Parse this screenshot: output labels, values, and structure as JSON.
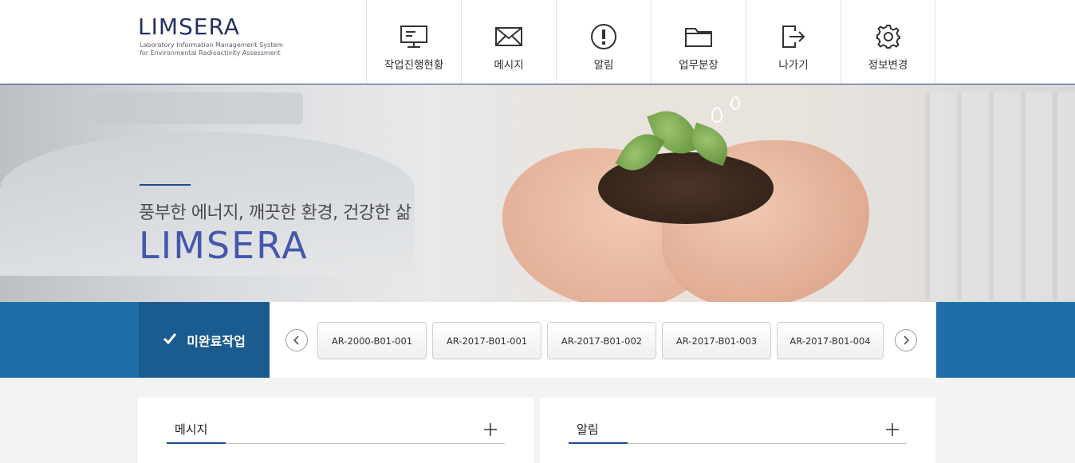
{
  "header": {
    "logo_title": "LIMSERA",
    "logo_sub_1": "Laboratory Information Management System",
    "logo_sub_2": "for Environmental Radioactivity Assessment",
    "nav": [
      {
        "label": "작업진행현황",
        "icon": "monitor-icon"
      },
      {
        "label": "메시지",
        "icon": "envelope-icon"
      },
      {
        "label": "알림",
        "icon": "alert-icon"
      },
      {
        "label": "업무분장",
        "icon": "folder-icon"
      },
      {
        "label": "나가기",
        "icon": "logout-icon"
      },
      {
        "label": "정보변경",
        "icon": "gear-icon"
      }
    ]
  },
  "banner": {
    "slogan": "풍부한 에너지, 깨끗한 환경, 건강한 삶",
    "brand": "LIMSERA"
  },
  "tasks": {
    "title": "미완료작업",
    "items": [
      "AR-2000-B01-001",
      "AR-2017-B01-001",
      "AR-2017-B01-002",
      "AR-2017-B01-003",
      "AR-2017-B01-004"
    ]
  },
  "panels": {
    "messages_title": "메시지",
    "alerts_title": "알림"
  },
  "colors": {
    "brand_blue": "#1e6fa8",
    "dark_blue": "#1a5b90",
    "brand_text": "#4557ad",
    "navy": "#25305e"
  }
}
